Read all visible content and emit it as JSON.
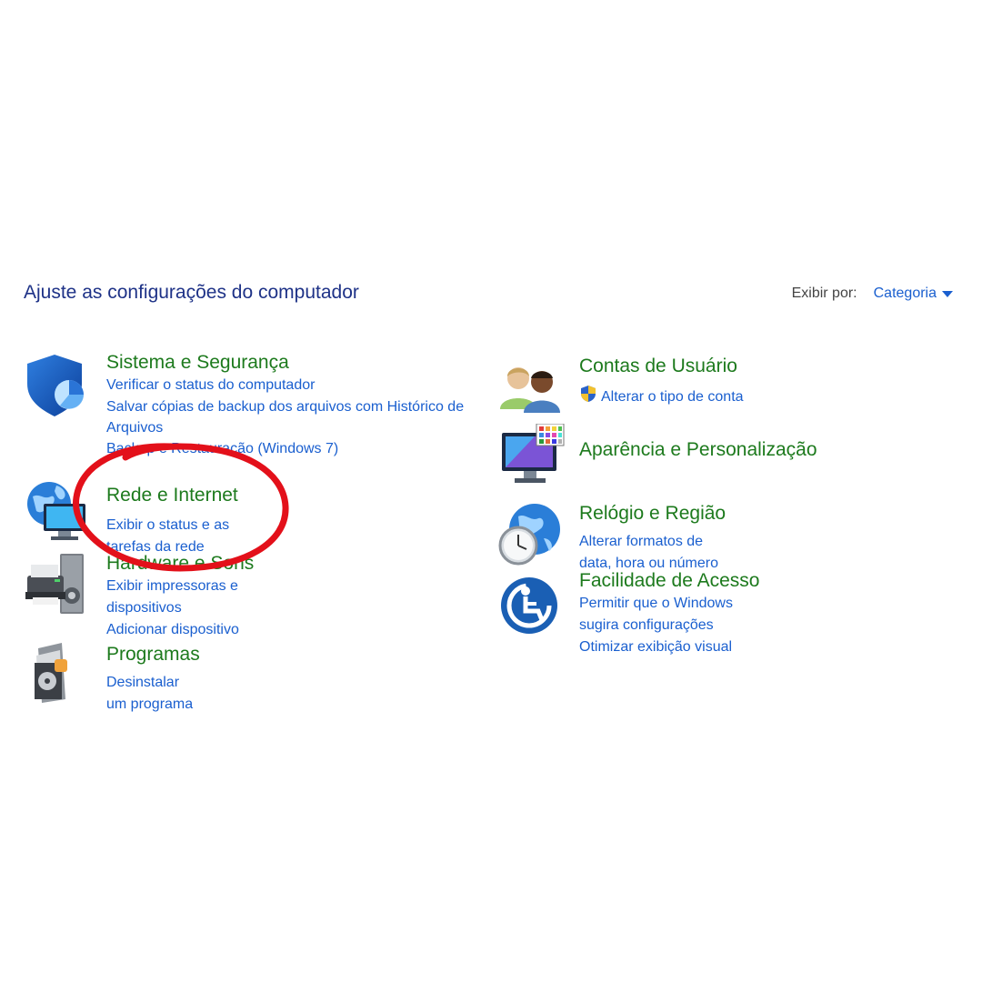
{
  "header": {
    "title": "Ajuste as configurações do computador",
    "view_by_label": "Exibir por:",
    "view_by_value": "Categoria"
  },
  "categories_left": [
    {
      "title": "Sistema e Segurança",
      "links": [
        "Verificar o status do computador",
        "Salvar cópias de backup dos arquivos com Histórico de Arquivos",
        "Backup e Restauração (Windows 7)"
      ]
    },
    {
      "title": "Rede e Internet",
      "links": [
        "Exibir o status e as tarefas da rede"
      ]
    },
    {
      "title": "Hardware e Sons",
      "links": [
        "Exibir impressoras e dispositivos",
        "Adicionar dispositivo"
      ]
    },
    {
      "title": "Programas",
      "links": [
        "Desinstalar um programa"
      ]
    }
  ],
  "categories_right": [
    {
      "title": "Contas de Usuário",
      "links": [
        "Alterar o tipo de conta"
      ]
    },
    {
      "title": "Aparência e Personalização",
      "links": []
    },
    {
      "title": "Relógio e Região",
      "links": [
        "Alterar formatos de data, hora ou número"
      ]
    },
    {
      "title": "Facilidade de Acesso",
      "links": [
        "Permitir que o Windows sugira configurações",
        "Otimizar exibição visual"
      ]
    }
  ],
  "icons": {
    "system_security": "shield-icon",
    "network_internet": "globe-network-icon",
    "hardware_sound": "printer-icon",
    "programs": "programs-box-icon",
    "user_accounts": "users-icon",
    "appearance": "monitor-palette-icon",
    "clock_region": "clock-globe-icon",
    "ease_of_access": "ease-of-access-icon",
    "uac_shield": "uac-shield-icon"
  },
  "colors": {
    "title": "#1e3287",
    "category_title": "#1d7a1d",
    "link": "#1a5fcf",
    "annotation": "#e3101a"
  }
}
